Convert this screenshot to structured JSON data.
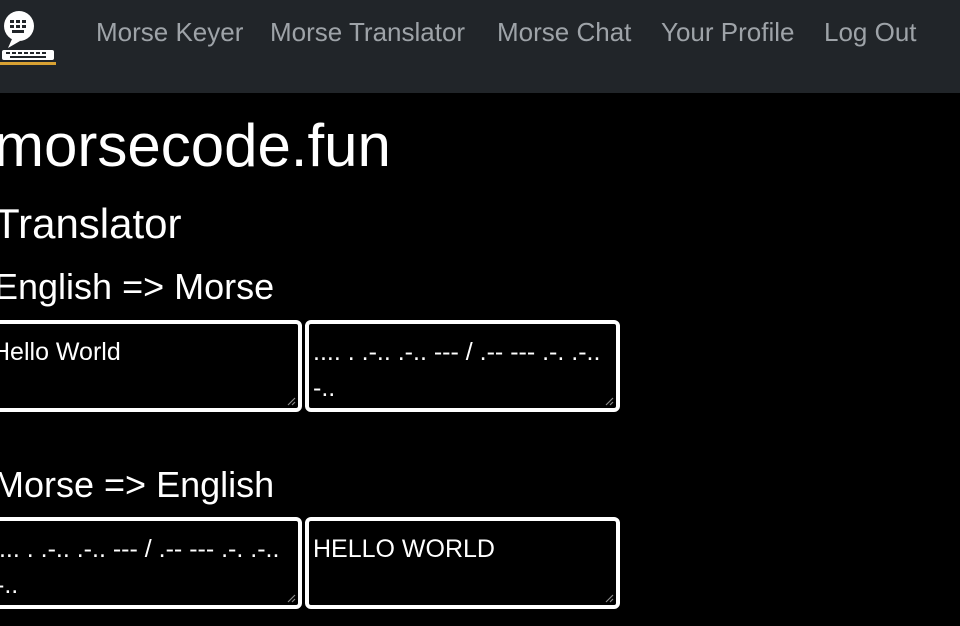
{
  "nav": {
    "logo_icon": "chat-keyboard-logo-icon",
    "links": [
      {
        "label": "Morse Keyer"
      },
      {
        "label": "Morse Translator"
      },
      {
        "label": "Morse Chat"
      },
      {
        "label": "Your Profile"
      },
      {
        "label": "Log Out"
      }
    ]
  },
  "site_title": "morsecode.fun",
  "page_heading": "Translator",
  "english_to_morse": {
    "heading": "English => Morse",
    "input_value": "Hello World",
    "output_value": ".... . .-.. .-.. --- / .-- --- .-. .-.. -.."
  },
  "morse_to_english": {
    "heading": "Morse => English",
    "input_value": ".... . .-.. .-.. --- / .-- --- .-. .-.. -..",
    "output_value": "HELLO WORLD"
  },
  "colors": {
    "navbar_bg": "#212529",
    "nav_link": "#9ea3a8",
    "page_bg": "#000000",
    "text": "#ffffff"
  }
}
